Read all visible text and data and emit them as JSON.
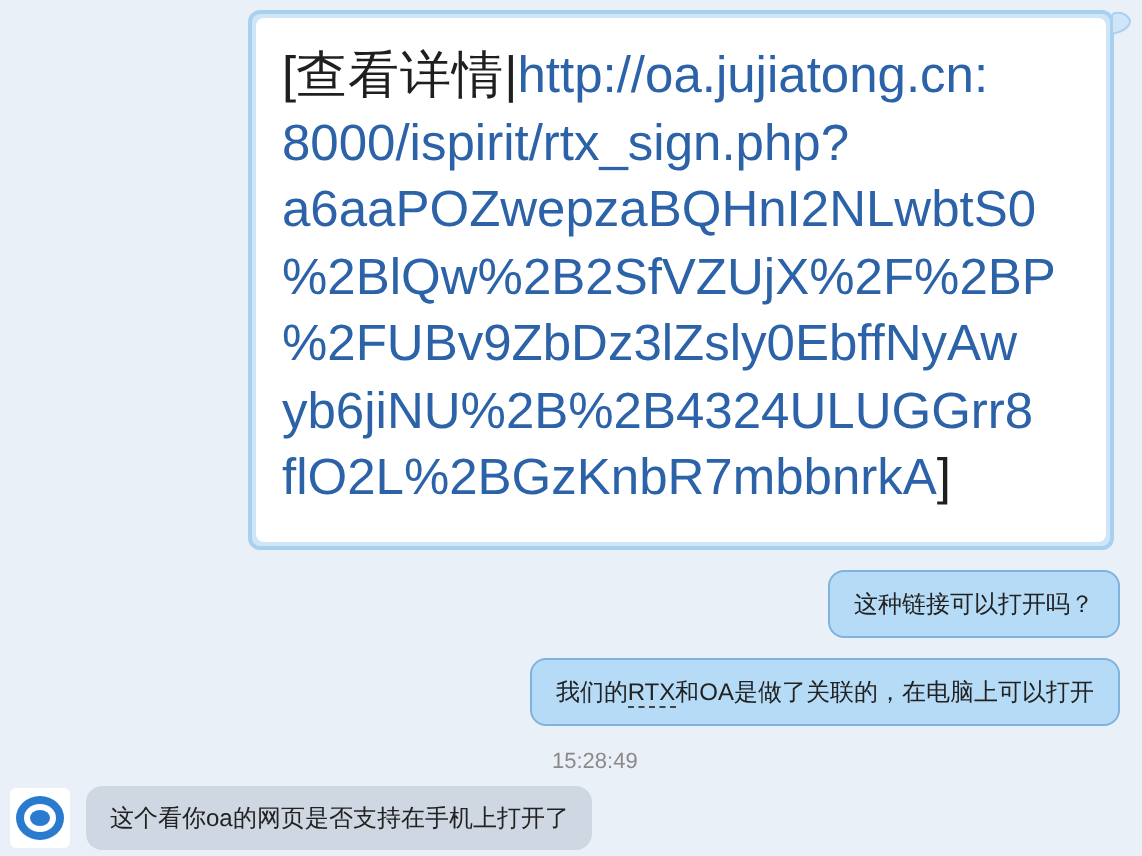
{
  "messages": [
    {
      "outgoing": true,
      "prefix": "[查看详情|",
      "link_lines": [
        "http://oa.jujiatong.cn:",
        "8000/ispirit/rtx_sign.php?",
        "a6aaPOZwepzaBQHnI2NLwbtS0",
        "%2BlQw%2B2SfVZUjX%2F%2BP",
        "%2FUBv9ZbDz3lZsly0EbffNyAw",
        "yb6jiNU%2B%2B4324ULUGGrr8",
        "flO2L%2BGzKnbR7mbbnrkA"
      ],
      "suffix": "]"
    },
    {
      "kind": "text",
      "outgoing": true,
      "parts": [
        {
          "text": "这种链接可以打开吗？"
        }
      ]
    },
    {
      "kind": "text",
      "outgoing": true,
      "parts": [
        {
          "text": "我们的"
        },
        {
          "text": "RTX",
          "link": true
        },
        {
          "text": "和OA是做了关联的，在电脑上可以打开"
        }
      ]
    },
    {
      "kind": "time",
      "text": "15:28:49"
    },
    {
      "kind": "text",
      "outgoing": false,
      "parts": [
        {
          "text": "这个看你oa的网页是否支持在手机上打开了"
        }
      ]
    }
  ]
}
